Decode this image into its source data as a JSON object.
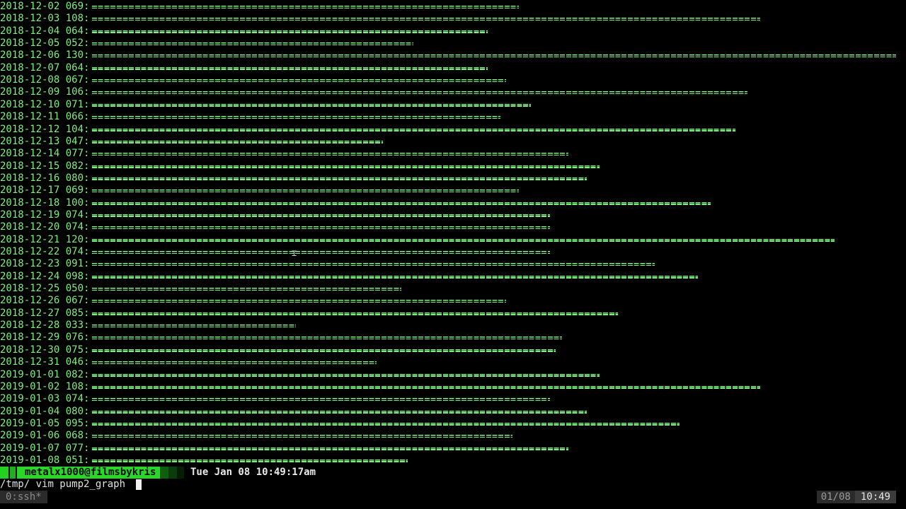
{
  "graph": {
    "bar_char": "=",
    "scale_max": 130,
    "rows": [
      {
        "date": "2018-12-02",
        "count": "069",
        "value": 69
      },
      {
        "date": "2018-12-03",
        "count": "108",
        "value": 108
      },
      {
        "date": "2018-12-04",
        "count": "064",
        "value": 64
      },
      {
        "date": "2018-12-05",
        "count": "052",
        "value": 52
      },
      {
        "date": "2018-12-06",
        "count": "130",
        "value": 130
      },
      {
        "date": "2018-12-07",
        "count": "064",
        "value": 64
      },
      {
        "date": "2018-12-08",
        "count": "067",
        "value": 67
      },
      {
        "date": "2018-12-09",
        "count": "106",
        "value": 106
      },
      {
        "date": "2018-12-10",
        "count": "071",
        "value": 71
      },
      {
        "date": "2018-12-11",
        "count": "066",
        "value": 66
      },
      {
        "date": "2018-12-12",
        "count": "104",
        "value": 104
      },
      {
        "date": "2018-12-13",
        "count": "047",
        "value": 47
      },
      {
        "date": "2018-12-14",
        "count": "077",
        "value": 77
      },
      {
        "date": "2018-12-15",
        "count": "082",
        "value": 82
      },
      {
        "date": "2018-12-16",
        "count": "080",
        "value": 80
      },
      {
        "date": "2018-12-17",
        "count": "069",
        "value": 69
      },
      {
        "date": "2018-12-18",
        "count": "100",
        "value": 100
      },
      {
        "date": "2018-12-19",
        "count": "074",
        "value": 74
      },
      {
        "date": "2018-12-20",
        "count": "074",
        "value": 74
      },
      {
        "date": "2018-12-21",
        "count": "120",
        "value": 120
      },
      {
        "date": "2018-12-22",
        "count": "074",
        "value": 74
      },
      {
        "date": "2018-12-23",
        "count": "091",
        "value": 91
      },
      {
        "date": "2018-12-24",
        "count": "098",
        "value": 98
      },
      {
        "date": "2018-12-25",
        "count": "050",
        "value": 50
      },
      {
        "date": "2018-12-26",
        "count": "067",
        "value": 67
      },
      {
        "date": "2018-12-27",
        "count": "085",
        "value": 85
      },
      {
        "date": "2018-12-28",
        "count": "033",
        "value": 33
      },
      {
        "date": "2018-12-29",
        "count": "076",
        "value": 76
      },
      {
        "date": "2018-12-30",
        "count": "075",
        "value": 75
      },
      {
        "date": "2018-12-31",
        "count": "046",
        "value": 46
      },
      {
        "date": "2019-01-01",
        "count": "082",
        "value": 82
      },
      {
        "date": "2019-01-02",
        "count": "108",
        "value": 108
      },
      {
        "date": "2019-01-03",
        "count": "074",
        "value": 74
      },
      {
        "date": "2019-01-04",
        "count": "080",
        "value": 80
      },
      {
        "date": "2019-01-05",
        "count": "095",
        "value": 95
      },
      {
        "date": "2019-01-06",
        "count": "068",
        "value": 68
      },
      {
        "date": "2019-01-07",
        "count": "077",
        "value": 77
      },
      {
        "date": "2019-01-08",
        "count": "051",
        "value": 51
      }
    ]
  },
  "prompt": {
    "user_host": "metalx1000@filmsbykris",
    "datetime": "Tue Jan 08 10:49:17am",
    "cwd": "/tmp/",
    "command": "vim pump2_graph"
  },
  "status_bar": {
    "window": "0:ssh*",
    "date": "01/08",
    "time": "10:49"
  },
  "colors": {
    "terminal_text": "#7cf07c",
    "background": "#000000",
    "prompt_accent": "#2ad62a"
  }
}
